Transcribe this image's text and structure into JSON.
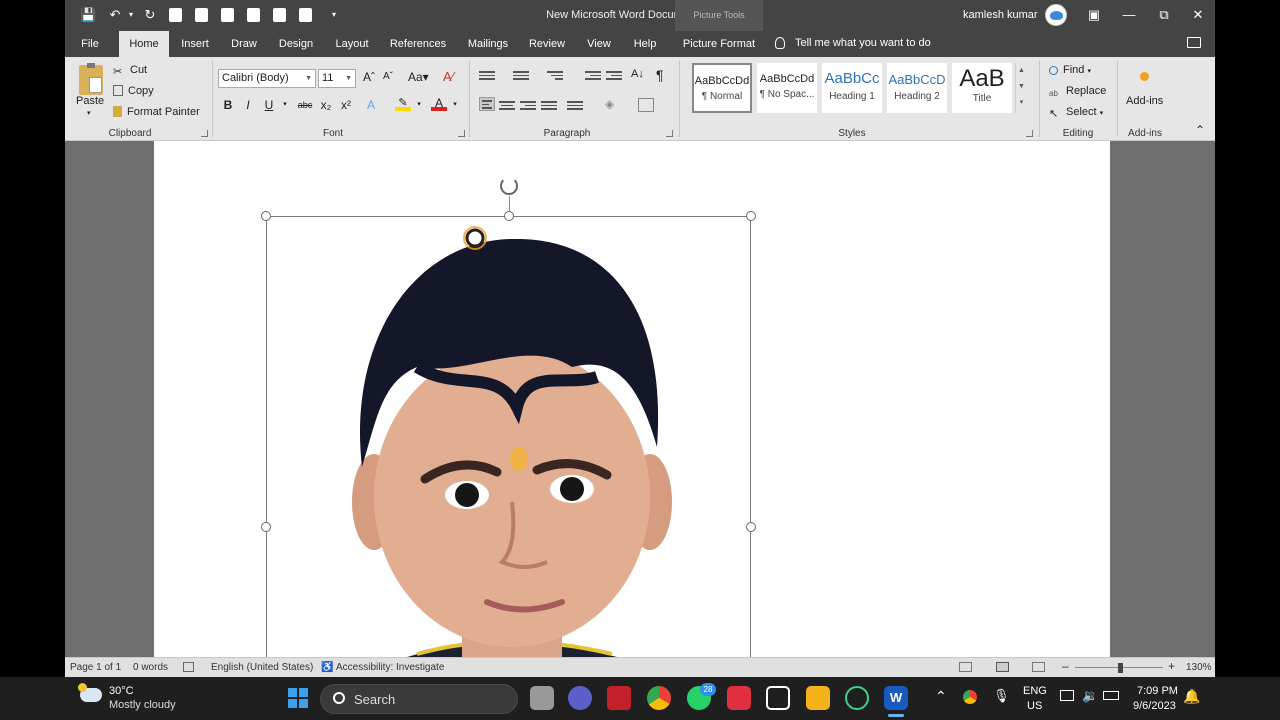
{
  "window": {
    "title": "New Microsoft Word Document  -  Word",
    "context_tab_group": "Picture Tools",
    "user": "kamlesh kumar"
  },
  "tabs": [
    "File",
    "Home",
    "Insert",
    "Draw",
    "Design",
    "Layout",
    "References",
    "Mailings",
    "Review",
    "View",
    "Help",
    "Picture Format"
  ],
  "active_tab": "Home",
  "tell_me": "Tell me what you want to do",
  "clipboard": {
    "paste": "Paste",
    "cut": "Cut",
    "copy": "Copy",
    "format_painter": "Format Painter",
    "group_label": "Clipboard"
  },
  "font": {
    "family": "Calibri (Body)",
    "size": "11",
    "group_label": "Font",
    "buttons": [
      "B",
      "I",
      "U",
      "abc",
      "x₂",
      "x²",
      "A",
      "A"
    ]
  },
  "paragraph": {
    "group_label": "Paragraph",
    "pilcrow": "¶"
  },
  "styles": {
    "group_label": "Styles",
    "items": [
      {
        "preview": "AaBbCcDd",
        "name": "¶ Normal"
      },
      {
        "preview": "AaBbCcDd",
        "name": "¶ No Spac..."
      },
      {
        "preview": "AaBbCc",
        "name": "Heading 1"
      },
      {
        "preview": "AaBbCcD",
        "name": "Heading 2"
      },
      {
        "preview": "AaB",
        "name": "Title"
      }
    ]
  },
  "editing": {
    "find": "Find",
    "replace": "Replace",
    "select": "Select",
    "group_label": "Editing"
  },
  "addins": {
    "label": "Add-ins",
    "group_label": "Add-ins"
  },
  "status": {
    "page": "Page 1 of 1",
    "words": "0 words",
    "language": "English (United States)",
    "accessibility": "Accessibility: Investigate",
    "zoom": "130%"
  },
  "taskbar": {
    "weather_temp": "30°C",
    "weather_desc": "Mostly cloudy",
    "search": "Search",
    "whatsapp_badge": "28",
    "lang_top": "ENG",
    "lang_bottom": "US",
    "time": "7:09 PM",
    "date": "9/6/2023"
  },
  "colors": {
    "titlebar": "#444444",
    "ribbon": "#e6e6e6",
    "canvas": "#6e6e6e",
    "highlight_yellow": "#ffd800",
    "font_red": "#e02020"
  }
}
